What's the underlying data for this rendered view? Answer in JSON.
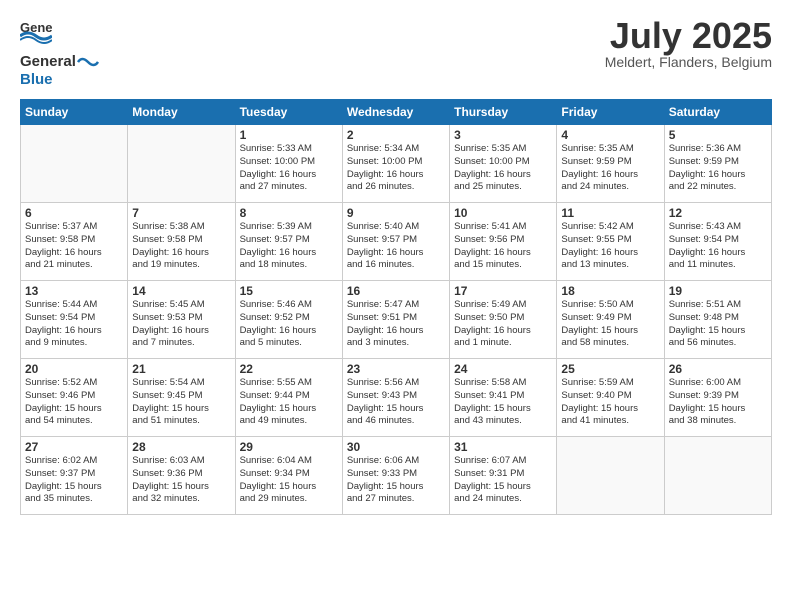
{
  "header": {
    "logo_general": "General",
    "logo_blue": "Blue",
    "month_title": "July 2025",
    "location": "Meldert, Flanders, Belgium"
  },
  "weekdays": [
    "Sunday",
    "Monday",
    "Tuesday",
    "Wednesday",
    "Thursday",
    "Friday",
    "Saturday"
  ],
  "weeks": [
    [
      {
        "day": "",
        "info": ""
      },
      {
        "day": "",
        "info": ""
      },
      {
        "day": "1",
        "info": "Sunrise: 5:33 AM\nSunset: 10:00 PM\nDaylight: 16 hours\nand 27 minutes."
      },
      {
        "day": "2",
        "info": "Sunrise: 5:34 AM\nSunset: 10:00 PM\nDaylight: 16 hours\nand 26 minutes."
      },
      {
        "day": "3",
        "info": "Sunrise: 5:35 AM\nSunset: 10:00 PM\nDaylight: 16 hours\nand 25 minutes."
      },
      {
        "day": "4",
        "info": "Sunrise: 5:35 AM\nSunset: 9:59 PM\nDaylight: 16 hours\nand 24 minutes."
      },
      {
        "day": "5",
        "info": "Sunrise: 5:36 AM\nSunset: 9:59 PM\nDaylight: 16 hours\nand 22 minutes."
      }
    ],
    [
      {
        "day": "6",
        "info": "Sunrise: 5:37 AM\nSunset: 9:58 PM\nDaylight: 16 hours\nand 21 minutes."
      },
      {
        "day": "7",
        "info": "Sunrise: 5:38 AM\nSunset: 9:58 PM\nDaylight: 16 hours\nand 19 minutes."
      },
      {
        "day": "8",
        "info": "Sunrise: 5:39 AM\nSunset: 9:57 PM\nDaylight: 16 hours\nand 18 minutes."
      },
      {
        "day": "9",
        "info": "Sunrise: 5:40 AM\nSunset: 9:57 PM\nDaylight: 16 hours\nand 16 minutes."
      },
      {
        "day": "10",
        "info": "Sunrise: 5:41 AM\nSunset: 9:56 PM\nDaylight: 16 hours\nand 15 minutes."
      },
      {
        "day": "11",
        "info": "Sunrise: 5:42 AM\nSunset: 9:55 PM\nDaylight: 16 hours\nand 13 minutes."
      },
      {
        "day": "12",
        "info": "Sunrise: 5:43 AM\nSunset: 9:54 PM\nDaylight: 16 hours\nand 11 minutes."
      }
    ],
    [
      {
        "day": "13",
        "info": "Sunrise: 5:44 AM\nSunset: 9:54 PM\nDaylight: 16 hours\nand 9 minutes."
      },
      {
        "day": "14",
        "info": "Sunrise: 5:45 AM\nSunset: 9:53 PM\nDaylight: 16 hours\nand 7 minutes."
      },
      {
        "day": "15",
        "info": "Sunrise: 5:46 AM\nSunset: 9:52 PM\nDaylight: 16 hours\nand 5 minutes."
      },
      {
        "day": "16",
        "info": "Sunrise: 5:47 AM\nSunset: 9:51 PM\nDaylight: 16 hours\nand 3 minutes."
      },
      {
        "day": "17",
        "info": "Sunrise: 5:49 AM\nSunset: 9:50 PM\nDaylight: 16 hours\nand 1 minute."
      },
      {
        "day": "18",
        "info": "Sunrise: 5:50 AM\nSunset: 9:49 PM\nDaylight: 15 hours\nand 58 minutes."
      },
      {
        "day": "19",
        "info": "Sunrise: 5:51 AM\nSunset: 9:48 PM\nDaylight: 15 hours\nand 56 minutes."
      }
    ],
    [
      {
        "day": "20",
        "info": "Sunrise: 5:52 AM\nSunset: 9:46 PM\nDaylight: 15 hours\nand 54 minutes."
      },
      {
        "day": "21",
        "info": "Sunrise: 5:54 AM\nSunset: 9:45 PM\nDaylight: 15 hours\nand 51 minutes."
      },
      {
        "day": "22",
        "info": "Sunrise: 5:55 AM\nSunset: 9:44 PM\nDaylight: 15 hours\nand 49 minutes."
      },
      {
        "day": "23",
        "info": "Sunrise: 5:56 AM\nSunset: 9:43 PM\nDaylight: 15 hours\nand 46 minutes."
      },
      {
        "day": "24",
        "info": "Sunrise: 5:58 AM\nSunset: 9:41 PM\nDaylight: 15 hours\nand 43 minutes."
      },
      {
        "day": "25",
        "info": "Sunrise: 5:59 AM\nSunset: 9:40 PM\nDaylight: 15 hours\nand 41 minutes."
      },
      {
        "day": "26",
        "info": "Sunrise: 6:00 AM\nSunset: 9:39 PM\nDaylight: 15 hours\nand 38 minutes."
      }
    ],
    [
      {
        "day": "27",
        "info": "Sunrise: 6:02 AM\nSunset: 9:37 PM\nDaylight: 15 hours\nand 35 minutes."
      },
      {
        "day": "28",
        "info": "Sunrise: 6:03 AM\nSunset: 9:36 PM\nDaylight: 15 hours\nand 32 minutes."
      },
      {
        "day": "29",
        "info": "Sunrise: 6:04 AM\nSunset: 9:34 PM\nDaylight: 15 hours\nand 29 minutes."
      },
      {
        "day": "30",
        "info": "Sunrise: 6:06 AM\nSunset: 9:33 PM\nDaylight: 15 hours\nand 27 minutes."
      },
      {
        "day": "31",
        "info": "Sunrise: 6:07 AM\nSunset: 9:31 PM\nDaylight: 15 hours\nand 24 minutes."
      },
      {
        "day": "",
        "info": ""
      },
      {
        "day": "",
        "info": ""
      }
    ]
  ]
}
